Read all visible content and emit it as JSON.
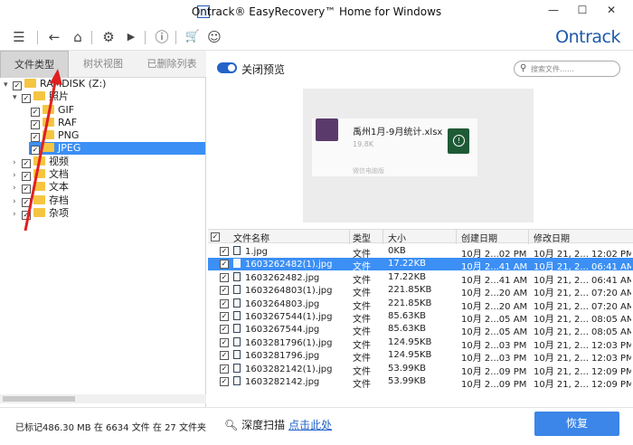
{
  "window": {
    "title": "Ontrack® EasyRecovery™ Home for Windows",
    "minimize": "—",
    "maximize": "☐",
    "close": "✕"
  },
  "toolbar": {
    "menu": "☰",
    "back": "←",
    "home": "⌂",
    "settings": "⚙",
    "play": "▶",
    "info": "ⓘ",
    "cart": "🛒",
    "user": "☺",
    "logo": "Ontrack"
  },
  "tabs": [
    "文件类型",
    "树状视图",
    "已删除列表"
  ],
  "tree": [
    {
      "label": "RAMDISK (Z:)",
      "expand": "▾",
      "checked": "✓"
    },
    {
      "label": "照片",
      "expand": "▾",
      "checked": "✓"
    },
    {
      "label": "GIF",
      "expand": "",
      "checked": "✓"
    },
    {
      "label": "RAF",
      "expand": "",
      "checked": "✓"
    },
    {
      "label": "PNG",
      "expand": "",
      "checked": "✓"
    },
    {
      "label": "JPEG",
      "expand": "",
      "checked": "✓"
    },
    {
      "label": "视频",
      "expand": "›",
      "checked": "✓"
    },
    {
      "label": "文档",
      "expand": "›",
      "checked": "✓"
    },
    {
      "label": "文本",
      "expand": "›",
      "checked": "✓"
    },
    {
      "label": "存档",
      "expand": "›",
      "checked": "✓"
    },
    {
      "label": "杂项",
      "expand": "›",
      "checked": "✓"
    }
  ],
  "preview": {
    "toggle_label": "关闭预览",
    "search_placeholder": "搜索文件……",
    "file_name": "禹州1月-9月统计.xlsx",
    "file_size": "19.8K",
    "caption": "微信电脑版"
  },
  "table": {
    "columns": [
      "文件名称",
      "类型",
      "大小",
      "创建日期",
      "修改日期"
    ],
    "rows": [
      {
        "name": "1.jpg",
        "type": "文件",
        "size": "0KB",
        "created": "10月 2...02 PM",
        "modified": "10月 21, 2... 12:02 PM"
      },
      {
        "name": "1603262482(1).jpg",
        "type": "文件",
        "size": "17.22KB",
        "created": "10月 2...41 AM",
        "modified": "10月 21, 2... 06:41 AM"
      },
      {
        "name": "1603262482.jpg",
        "type": "文件",
        "size": "17.22KB",
        "created": "10月 2...41 AM",
        "modified": "10月 21, 2... 06:41 AM"
      },
      {
        "name": "1603264803(1).jpg",
        "type": "文件",
        "size": "221.85KB",
        "created": "10月 2...20 AM",
        "modified": "10月 21, 2... 07:20 AM"
      },
      {
        "name": "1603264803.jpg",
        "type": "文件",
        "size": "221.85KB",
        "created": "10月 2...20 AM",
        "modified": "10月 21, 2... 07:20 AM"
      },
      {
        "name": "1603267544(1).jpg",
        "type": "文件",
        "size": "85.63KB",
        "created": "10月 2...05 AM",
        "modified": "10月 21, 2... 08:05 AM"
      },
      {
        "name": "1603267544.jpg",
        "type": "文件",
        "size": "85.63KB",
        "created": "10月 2...05 AM",
        "modified": "10月 21, 2... 08:05 AM"
      },
      {
        "name": "1603281796(1).jpg",
        "type": "文件",
        "size": "124.95KB",
        "created": "10月 2...03 PM",
        "modified": "10月 21, 2... 12:03 PM"
      },
      {
        "name": "1603281796.jpg",
        "type": "文件",
        "size": "124.95KB",
        "created": "10月 2...03 PM",
        "modified": "10月 21, 2... 12:03 PM"
      },
      {
        "name": "1603282142(1).jpg",
        "type": "文件",
        "size": "53.99KB",
        "created": "10月 2...09 PM",
        "modified": "10月 21, 2... 12:09 PM"
      },
      {
        "name": "1603282142.jpg",
        "type": "文件",
        "size": "53.99KB",
        "created": "10月 2...09 PM",
        "modified": "10月 21, 2... 12:09 PM"
      }
    ]
  },
  "footer": {
    "status_prefix": "已标记",
    "status_size": "486.30 MB",
    "status_mid": "在",
    "status_files": "6634",
    "status_files_label": "文件 在",
    "status_folders": "27",
    "status_folders_label": "文件夹",
    "deep_scan_label": "深度扫描",
    "deep_scan_link": "点击此处",
    "recover_button": "恢复"
  },
  "colors": {
    "accent": "#3b8ff5",
    "button": "#3b86e8",
    "logo": "#1e5aa8",
    "annotation_arrow": "#e02020"
  }
}
